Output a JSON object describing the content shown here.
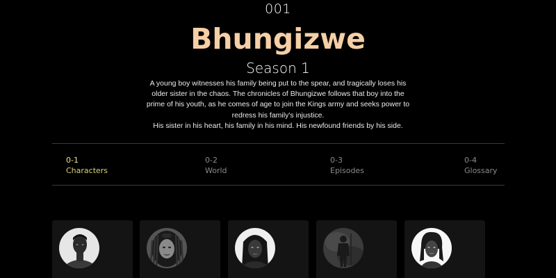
{
  "header": {
    "number": "001",
    "title": "Bhungizwe",
    "season": "Season 1",
    "synopsis_lines": [
      "A young boy witnesses his family being put to the spear, and tragically loses his older sister in the chaos. The chronicles of Bhungizwe follows that boy into the prime of his youth, as he comes of age to join the Kings army and seeks power to redress his family's injustice.",
      "His sister in his heart, his family in his mind. His newfound friends by his side."
    ]
  },
  "nav": {
    "tabs": [
      {
        "num": "0-1",
        "label": "Characters",
        "active": true
      },
      {
        "num": "0-2",
        "label": "World",
        "active": false
      },
      {
        "num": "0-3",
        "label": "Episodes",
        "active": false
      },
      {
        "num": "0-4",
        "label": "Glossary",
        "active": false
      }
    ]
  },
  "characters": {
    "cards": [
      {
        "avatar": "portrait-man-icon"
      },
      {
        "avatar": "portrait-locs-icon"
      },
      {
        "avatar": "portrait-woman-braids-icon"
      },
      {
        "avatar": "portrait-warrior-icon"
      },
      {
        "avatar": "portrait-woman-curls-icon"
      }
    ]
  },
  "colors": {
    "background": "#000000",
    "title": "#f5cfa6",
    "active_tab": "#f1e28a",
    "inactive_tab": "#8a8a8a",
    "card": "#141414",
    "divider": "#3a3a3a"
  }
}
